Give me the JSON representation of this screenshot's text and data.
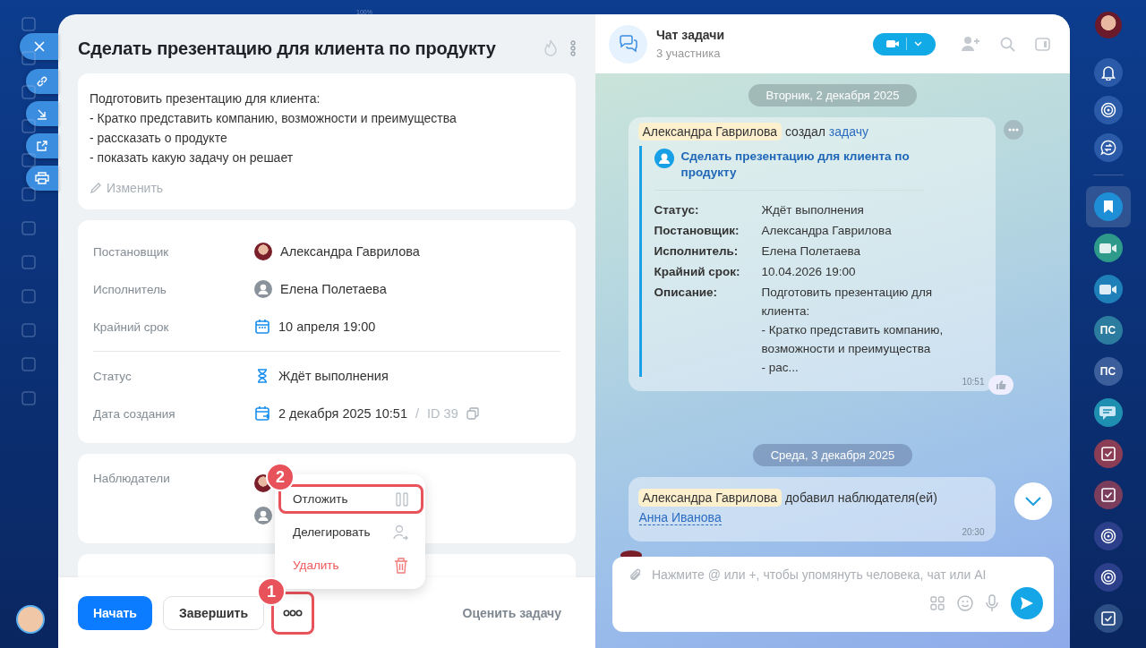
{
  "zoom_label": "100%",
  "task": {
    "title": "Сделать презентацию для клиента по продукту",
    "description": [
      "Подготовить презентацию для клиента:",
      "- Кратко представить компанию, возможности и преимущества",
      "- рассказать о продукте",
      "- показать какую задачу он решает"
    ],
    "edit_link": "Изменить",
    "fields": [
      {
        "label": "Постановщик",
        "kind": "person",
        "value": "Александра Гаврилова"
      },
      {
        "label": "Исполнитель",
        "kind": "user",
        "value": "Елена Полетаева"
      },
      {
        "label": "Крайний срок",
        "kind": "date",
        "value": "10 апреля 19:00"
      },
      {
        "label": "Статус",
        "kind": "status",
        "value": "Ждёт выполнения"
      },
      {
        "label": "Дата создания",
        "kind": "created",
        "value": "2 декабря 2025 10:51",
        "separator": "/",
        "id": "ID 39"
      }
    ],
    "observers_label": "Наблюдатели",
    "menu": [
      {
        "label": "Отложить",
        "kind": "pause",
        "highlighted": true
      },
      {
        "label": "Делегировать",
        "kind": "delegate",
        "highlighted": false
      },
      {
        "label": "Удалить",
        "kind": "delete",
        "highlighted": false
      }
    ],
    "callouts": [
      "2",
      "1"
    ],
    "footer": {
      "start": "Начать",
      "finish": "Завершить",
      "more_highlighted": true,
      "rate": "Оценить задачу"
    }
  },
  "chat": {
    "title": "Чат задачи",
    "subtitle": "3 участника",
    "composer_placeholder": "Нажмите @ или +, чтобы упомянуть человека, чат или AI",
    "messages": [
      {
        "kind": "date",
        "text": "Вторник, 2 декабря 2025"
      },
      {
        "kind": "task-card",
        "author": "Александра Гаврилова",
        "action": "создал",
        "link": "задачу",
        "card_title": "Сделать презентацию для клиента по продукту",
        "fields": [
          {
            "label": "Статус:",
            "value": "Ждёт выполнения"
          },
          {
            "label": "Постановщик:",
            "value": "Александра Гаврилова"
          },
          {
            "label": "Исполнитель:",
            "value": "Елена Полетаева"
          },
          {
            "label": "Крайний срок:",
            "value": "10.04.2026 19:00"
          },
          {
            "label": "Описание:",
            "value": "Подготовить презентацию для клиента:\n- Кратко представить компанию, возможности и преимущества\n- рас..."
          }
        ],
        "time": "10:51"
      },
      {
        "kind": "date",
        "text": "Среда, 3 декабря 2025"
      },
      {
        "kind": "event",
        "author": "Александра Гаврилова",
        "action": "добавил наблюдателя(ей)",
        "link": "Анна Иванова",
        "time": "20:30"
      }
    ]
  },
  "rail": [
    {
      "kind": "bell",
      "color": "#2a5aa8"
    },
    {
      "kind": "copilot",
      "color": "#2a5aa8"
    },
    {
      "kind": "chats",
      "color": "#2a5aa8"
    },
    {
      "kind": "bookmark",
      "color": "#1e8fd6",
      "selected": true
    },
    {
      "kind": "video",
      "color": "#2d9a8a",
      "selected": false
    },
    {
      "kind": "video",
      "color": "#1f7fb8",
      "selected": false
    },
    {
      "kind": "initials",
      "text": "ПС",
      "color": "#2b7c9e",
      "selected": false
    },
    {
      "kind": "initials",
      "text": "ПС",
      "color": "#3c5f9c",
      "selected": false
    },
    {
      "kind": "chat",
      "color": "#1e8fb0",
      "selected": false
    },
    {
      "kind": "task",
      "color": "#8a3d55",
      "selected": false
    },
    {
      "kind": "task",
      "color": "#7a3d5c",
      "selected": false
    },
    {
      "kind": "copilot",
      "color": "#2b3f8a",
      "selected": false
    },
    {
      "kind": "copilot",
      "color": "#2b3f8a",
      "selected": false
    },
    {
      "kind": "task",
      "color": "#2c4f85",
      "selected": false
    }
  ]
}
